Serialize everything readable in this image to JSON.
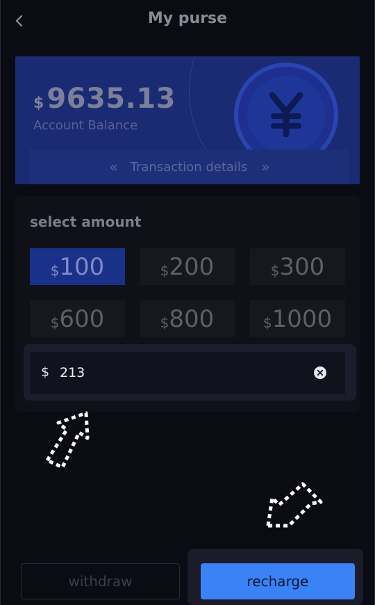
{
  "header": {
    "title": "My purse",
    "back_icon": "chevron-left-icon"
  },
  "balance_card": {
    "currency": "$",
    "amount": "9635.13",
    "label": "Account Balance",
    "icon": "yen-coin-icon",
    "tx_link": {
      "left_icon": "double-chevron-left-icon",
      "label": "Transaction details",
      "right_icon": "double-chevron-right-icon"
    }
  },
  "amount_panel": {
    "title": "select amount",
    "options": [
      {
        "currency": "$",
        "value": "100",
        "selected": true
      },
      {
        "currency": "$",
        "value": "200",
        "selected": false
      },
      {
        "currency": "$",
        "value": "300",
        "selected": false
      },
      {
        "currency": "$",
        "value": "600",
        "selected": false
      },
      {
        "currency": "$",
        "value": "800",
        "selected": false
      },
      {
        "currency": "$",
        "value": "1000",
        "selected": false
      }
    ],
    "input": {
      "currency": "$",
      "value": "213",
      "clear_icon": "clear-circle-icon"
    }
  },
  "footer": {
    "withdraw_label": "withdraw",
    "recharge_label": "recharge"
  },
  "colors": {
    "accent": "#3b82f6",
    "selected": "#1a318a",
    "card": "#1a2b73",
    "background": "#0b0b14"
  }
}
